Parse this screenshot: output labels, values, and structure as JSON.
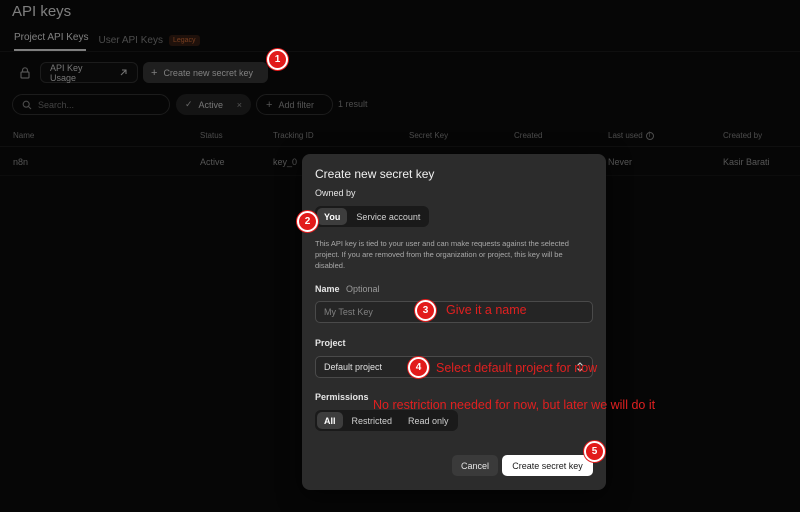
{
  "header": {
    "title": "API keys",
    "tabs": [
      {
        "label": "Project API Keys"
      },
      {
        "label": "User API Keys",
        "badge": "Legacy"
      }
    ]
  },
  "toolbar": {
    "usage_label": "API Key Usage",
    "create_label": "Create new secret key",
    "search_placeholder": "Search...",
    "filter_chip": "Active",
    "add_filter": "Add filter",
    "result_count": "1 result"
  },
  "table": {
    "columns": [
      "Name",
      "Status",
      "Tracking ID",
      "Secret Key",
      "Created",
      "Last used",
      "Created by"
    ],
    "rows": [
      {
        "name": "n8n",
        "status": "Active",
        "tracking_id": "key_0",
        "last_used": "Never",
        "created_by": "Kasir Barati"
      }
    ]
  },
  "dialog": {
    "title": "Create new secret key",
    "owned_by_label": "Owned by",
    "owned_options": [
      "You",
      "Service account"
    ],
    "owned_selected": "You",
    "help_text": "This API key is tied to your user and can make requests against the selected project. If you are removed from the organization or project, this key will be disabled.",
    "name_label": "Name",
    "name_optional": "Optional",
    "name_placeholder": "My Test Key",
    "project_label": "Project",
    "project_value": "Default project",
    "permissions_label": "Permissions",
    "permission_options": [
      "All",
      "Restricted",
      "Read only"
    ],
    "permission_selected": "All",
    "cancel_label": "Cancel",
    "submit_label": "Create secret key"
  },
  "annotations": {
    "steps": [
      "1",
      "2",
      "3",
      "4",
      "5"
    ],
    "name_note": "Give it a name",
    "project_note": "Select default project for now",
    "permission_note": "No restriction needed for now, but later we will do it"
  },
  "colors": {
    "background": "#0b0b0b",
    "dialog": "#2c2c2c",
    "annotation_red": "#e21b1b",
    "legacy_badge": "#d9713a"
  },
  "icons": [
    "lock-icon",
    "external-arrow-icon",
    "plus-icon",
    "search-icon",
    "check-icon",
    "close-icon",
    "info-icon",
    "chevron-updown-icon"
  ]
}
